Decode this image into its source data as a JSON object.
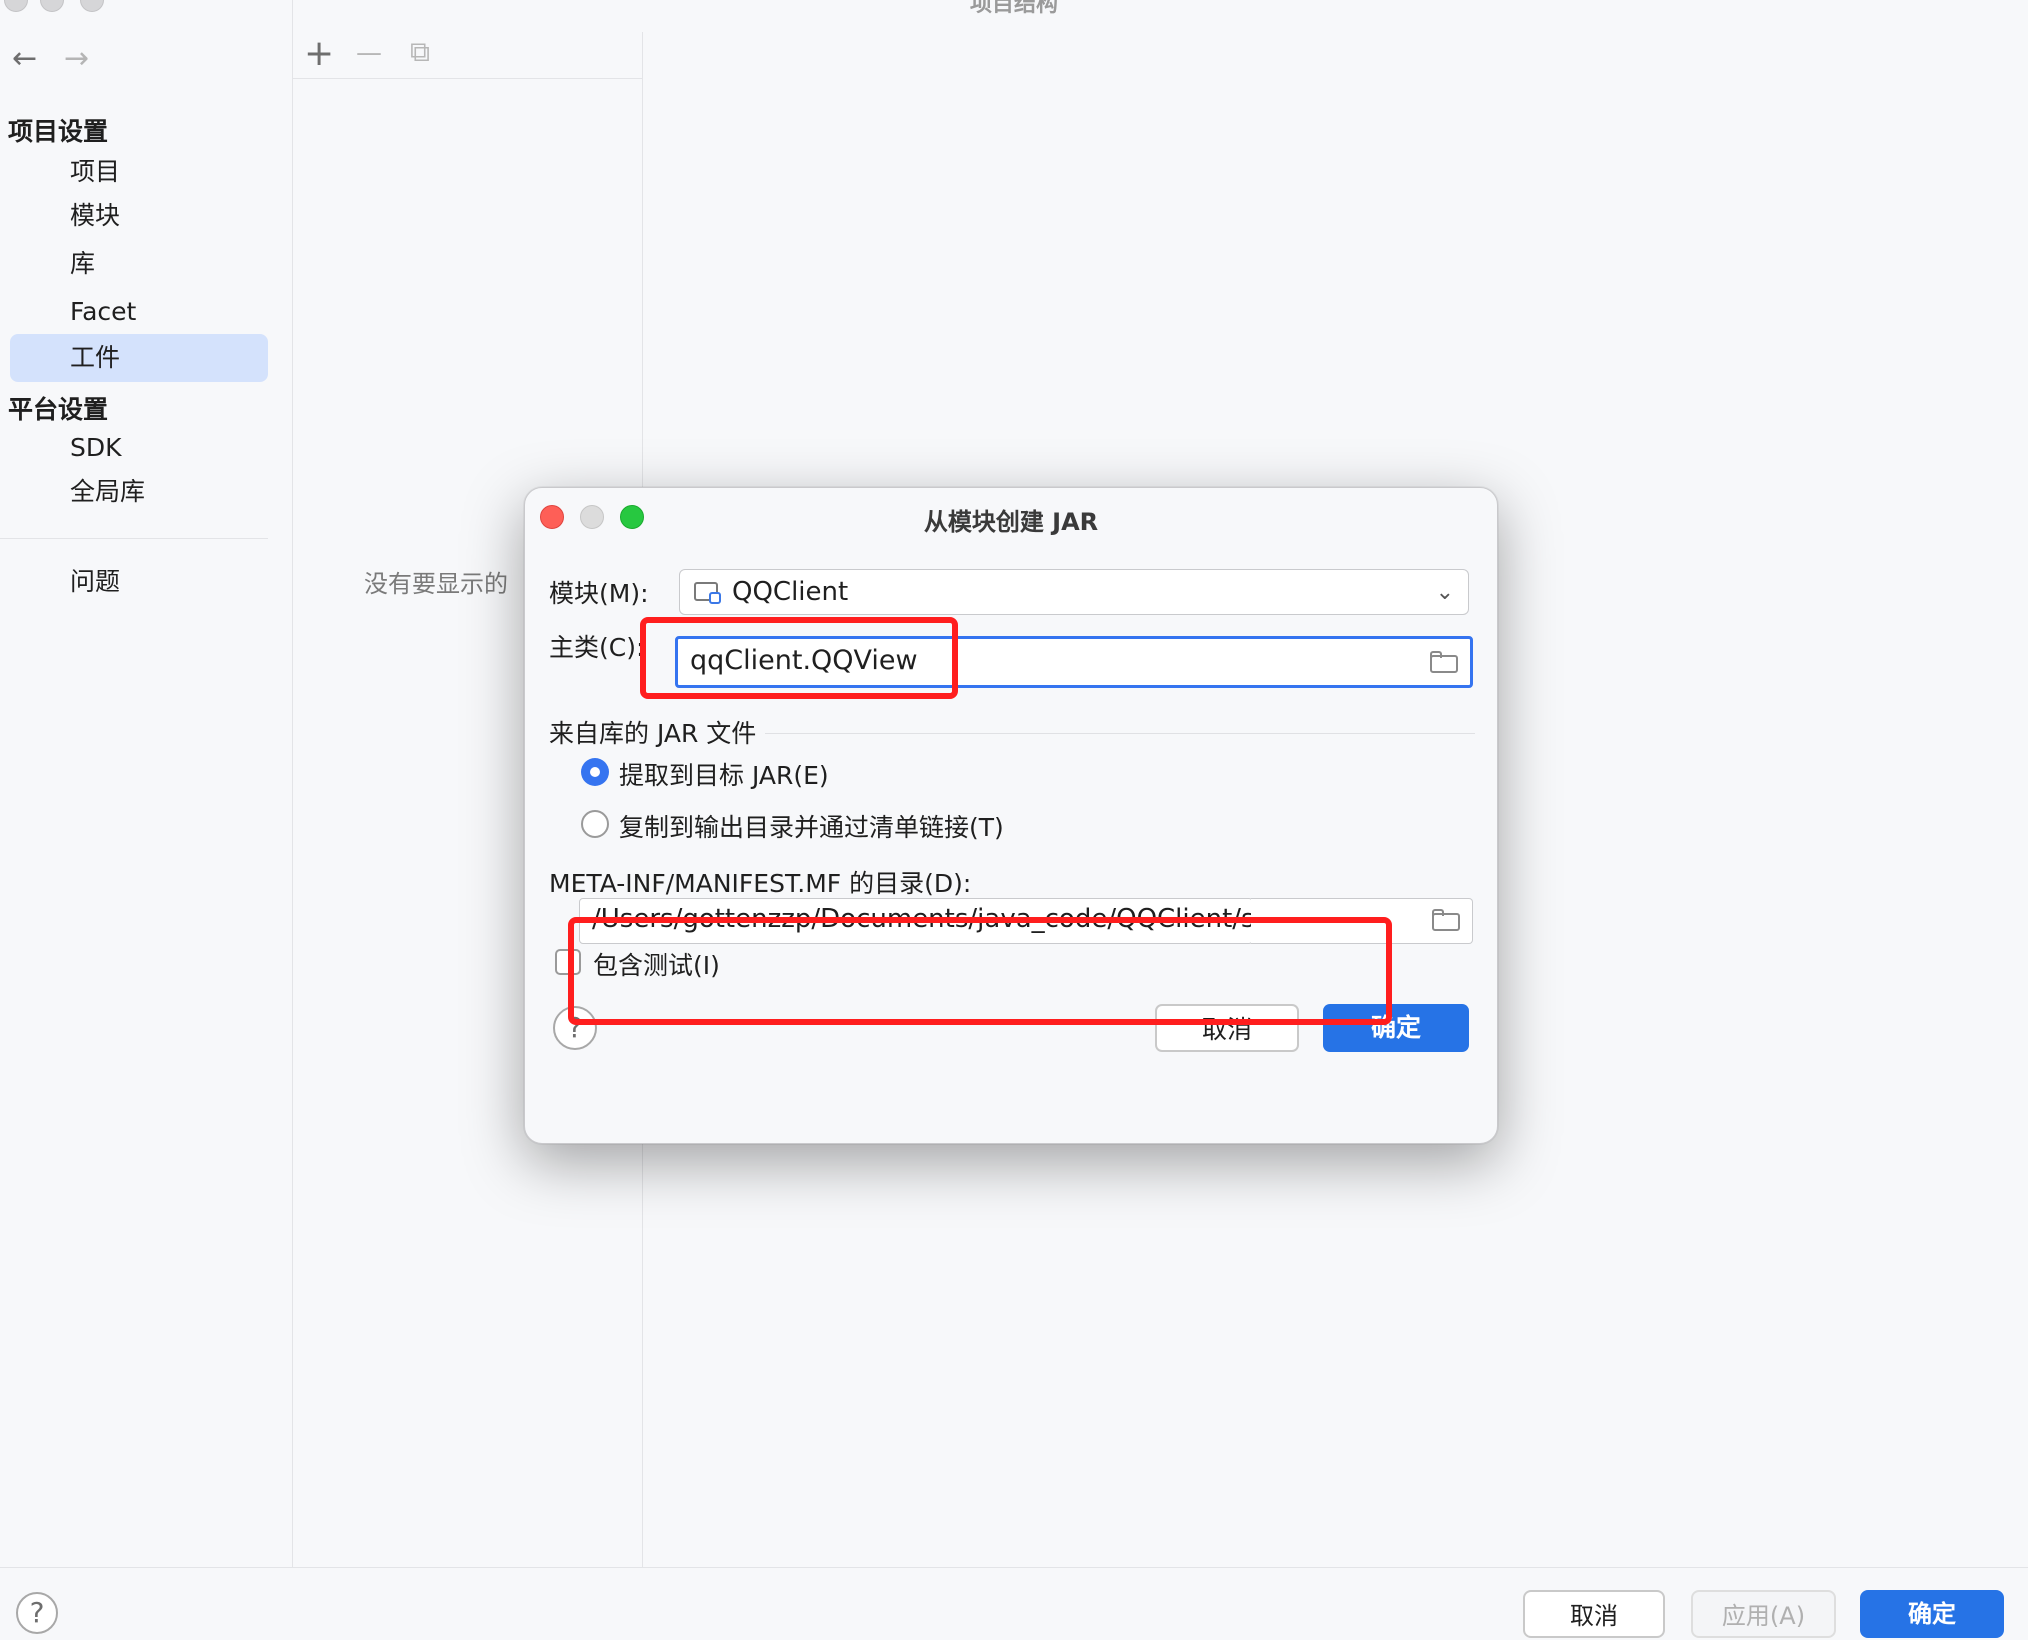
{
  "window": {
    "title": "项目结构",
    "nav": {
      "back": "←",
      "forward": "→"
    },
    "toolbar": {
      "add": "+",
      "remove": "—",
      "copy": "⧉"
    },
    "empty_message": "没有要显示的",
    "help": "?"
  },
  "sidebar": {
    "project_settings_header": "项目设置",
    "project_items": [
      {
        "label": "项目"
      },
      {
        "label": "模块"
      },
      {
        "label": "库"
      },
      {
        "label": "Facet"
      },
      {
        "label": "工件",
        "selected": true
      }
    ],
    "platform_settings_header": "平台设置",
    "platform_items": [
      {
        "label": "SDK"
      },
      {
        "label": "全局库"
      }
    ],
    "problems_label": "问题"
  },
  "bottom_buttons": {
    "cancel": "取消",
    "apply": "应用(A)",
    "ok": "确定"
  },
  "dialog": {
    "title": "从模块创建 JAR",
    "module_label": "模块(M):",
    "module_value": "QQClient",
    "main_class_label": "主类(C):",
    "main_class_value": "qqClient.QQView",
    "jar_group_label": "来自库的 JAR 文件",
    "radio_extract": "提取到目标 JAR(E)",
    "radio_copy": "复制到输出目录并通过清单链接(T)",
    "radio_selected": "extract",
    "manifest_label": "META-INF/MANIFEST.MF 的目录(D):",
    "manifest_value": "/Users/gottenzzp/Documents/java_code/QQClient/src",
    "include_tests_label": "包含测试(I)",
    "include_tests_checked": false,
    "help": "?",
    "cancel": "取消",
    "ok": "确定"
  },
  "colors": {
    "accent": "#2673e6",
    "highlight": "#ff1e1e",
    "selection": "#d4e2fc"
  }
}
